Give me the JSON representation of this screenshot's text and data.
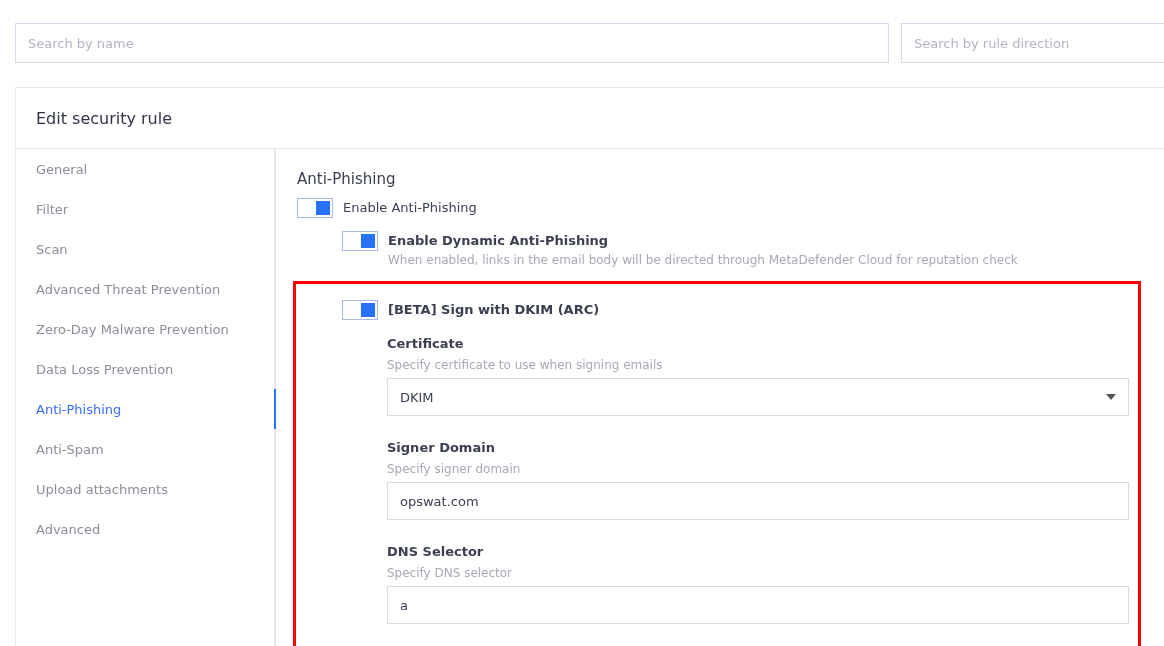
{
  "search_fields": [
    {
      "placeholder": "Search by name"
    },
    {
      "placeholder": "Search by rule direction"
    }
  ],
  "card": {
    "title": "Edit security rule",
    "nav_items": [
      {
        "label": "General",
        "selected": false
      },
      {
        "label": "Filter",
        "selected": false
      },
      {
        "label": "Scan",
        "selected": false
      },
      {
        "label": "Advanced Threat Prevention",
        "selected": false
      },
      {
        "label": "Zero-Day Malware Prevention",
        "selected": false
      },
      {
        "label": "Data Loss Prevention",
        "selected": false
      },
      {
        "label": "Anti-Phishing",
        "selected": true
      },
      {
        "label": "Anti-Spam",
        "selected": false
      },
      {
        "label": "Upload attachments",
        "selected": false
      },
      {
        "label": "Advanced",
        "selected": false
      }
    ],
    "section_title": "Anti-Phishing",
    "main_toggle": {
      "label": "Enable Anti-Phishing",
      "on": true
    },
    "dynamic_toggle": {
      "label": "Enable Dynamic Anti-Phishing",
      "on": true,
      "description": "When enabled, links in the email body will be directed through MetaDefender Cloud for reputation check"
    },
    "dkim": {
      "toggle": {
        "label": "[BETA] Sign with DKIM (ARC)",
        "on": true
      },
      "fields": [
        {
          "kind": "select",
          "label": "Certificate",
          "hint": "Specify certificate to use when signing emails",
          "value": "DKIM"
        },
        {
          "kind": "text",
          "label": "Signer Domain",
          "hint": "Specify signer domain",
          "value": "opswat.com"
        },
        {
          "kind": "text",
          "label": "DNS Selector",
          "hint": "Specify DNS selector",
          "value": "a"
        }
      ]
    }
  }
}
